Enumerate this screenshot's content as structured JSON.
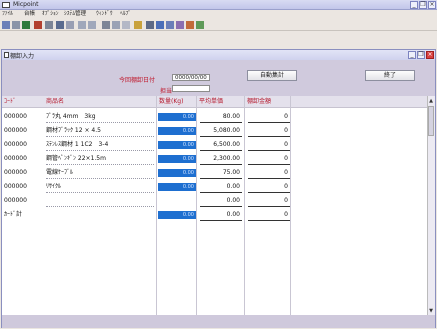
{
  "app": {
    "title": "Micpoint",
    "menu": [
      "ﾌｧｲﾙ",
      "台帳",
      "ｵﾌﾟｼｮﾝ",
      "ｼｽﾃﾑ管理",
      "ｳｨﾝﾄﾞｳ",
      "ﾍﾙﾌﾟ"
    ]
  },
  "window": {
    "title": "棚卸入力",
    "date_label": "今回棚卸日付",
    "date_value": "0000/00/00",
    "staff_label": "担当",
    "staff_value": "",
    "auto_button": "自動集計",
    "end_button": "終了"
  },
  "table": {
    "headers": [
      "ｺｰﾄﾞ",
      "商品名",
      "数量(Kg)",
      "平均単価",
      "棚卸金額"
    ],
    "rows": [
      {
        "code": "000000",
        "name": "ﾌﾟﾗ丸 4mm　3kg",
        "qty": "0.00",
        "price": "80.00",
        "amount": "0"
      },
      {
        "code": "000000",
        "name": "鋼材ﾌﾞﾗｯｸ 12 × 4.5",
        "qty": "0.00",
        "price": "5,080.00",
        "amount": "0"
      },
      {
        "code": "000000",
        "name": "ｽﾃﾝﾚｽ鋼材 1 1C2　3-4",
        "qty": "0.00",
        "price": "6,500.00",
        "amount": "0"
      },
      {
        "code": "000000",
        "name": "鋼管ﾍﾟﾝｷﾞﾝ 22×1.5m",
        "qty": "0.00",
        "price": "2,300.00",
        "amount": "0"
      },
      {
        "code": "000000",
        "name": "電線ｹｰﾌﾞﾙ",
        "qty": "0.00",
        "price": "75.00",
        "amount": "0"
      },
      {
        "code": "000000",
        "name": "ﾘｻｲｸﾙ",
        "qty": "0.00",
        "price": "0.00",
        "amount": "0"
      },
      {
        "code": "000000",
        "name": "",
        "qty": "",
        "price": "0.00",
        "amount": "0"
      },
      {
        "code": "ｶｰﾄﾞ計",
        "name": "",
        "qty": "0.00",
        "price": "0.00",
        "amount": "0"
      }
    ]
  }
}
